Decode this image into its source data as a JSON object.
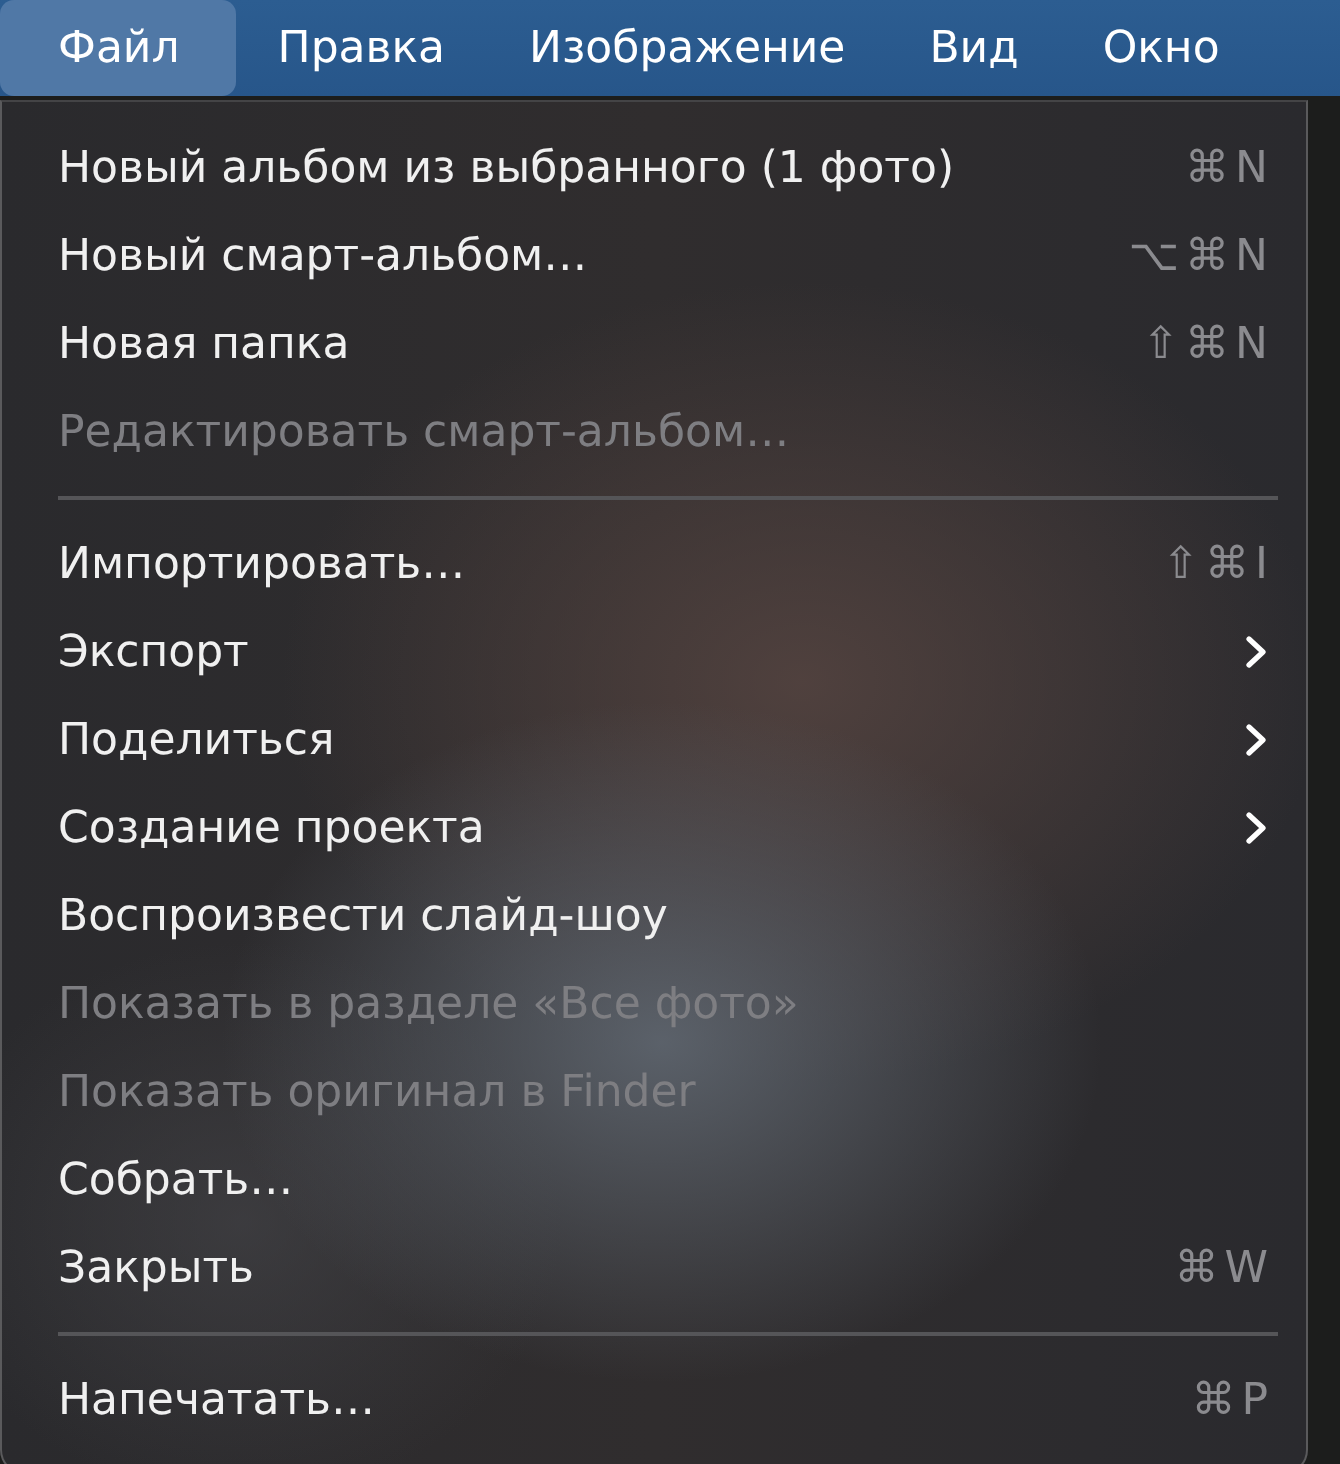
{
  "menu_bar": {
    "items": [
      {
        "label": "Файл",
        "selected": true
      },
      {
        "label": "Правка",
        "selected": false
      },
      {
        "label": "Изображение",
        "selected": false
      },
      {
        "label": "Вид",
        "selected": false
      },
      {
        "label": "Окно",
        "selected": false
      }
    ]
  },
  "menu": {
    "items": [
      {
        "kind": "command",
        "label": "Новый альбом из выбранного (1 фото)",
        "shortcut": "⌘N",
        "disabled": false
      },
      {
        "kind": "command",
        "label": "Новый смарт-альбом…",
        "shortcut": "⌥⌘N",
        "disabled": false
      },
      {
        "kind": "command",
        "label": "Новая папка",
        "shortcut": "⇧⌘N",
        "disabled": false
      },
      {
        "kind": "command",
        "label": "Редактировать смарт-альбом…",
        "disabled": true
      },
      {
        "kind": "separator"
      },
      {
        "kind": "command",
        "label": "Импортировать…",
        "shortcut": "⇧⌘I",
        "disabled": false
      },
      {
        "kind": "submenu",
        "label": "Экспорт",
        "disabled": false
      },
      {
        "kind": "submenu",
        "label": "Поделиться",
        "disabled": false
      },
      {
        "kind": "submenu",
        "label": "Создание проекта",
        "disabled": false
      },
      {
        "kind": "command",
        "label": "Воспроизвести слайд-шоу",
        "disabled": false
      },
      {
        "kind": "command",
        "label": "Показать в разделе «Все фото»",
        "disabled": true
      },
      {
        "kind": "command",
        "label": "Показать оригинал в Finder",
        "disabled": true
      },
      {
        "kind": "command",
        "label": "Собрать…",
        "disabled": false
      },
      {
        "kind": "command",
        "label": "Закрыть",
        "shortcut": "⌘W",
        "disabled": false
      },
      {
        "kind": "separator"
      },
      {
        "kind": "command",
        "label": "Напечатать…",
        "shortcut": "⌘P",
        "disabled": false
      }
    ]
  }
}
